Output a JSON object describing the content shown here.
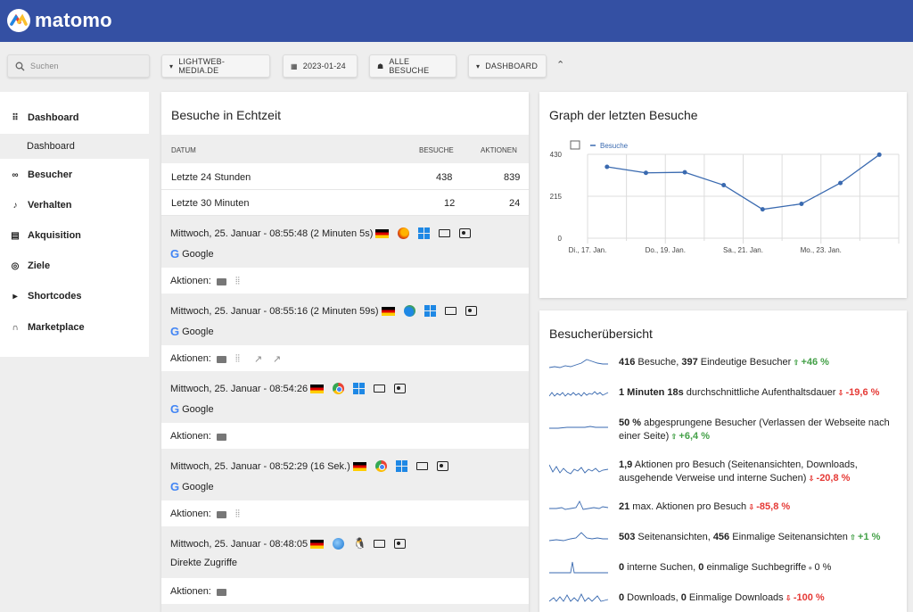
{
  "app": {
    "logo_text": "matomo"
  },
  "toolbar": {
    "search_placeholder": "Suchen",
    "site": "LIGHTWEB-MEDIA.DE",
    "date": "2023-01-24",
    "segment": "ALLE BESUCHE",
    "dashboard": "DASHBOARD"
  },
  "sidebar": {
    "items": [
      {
        "label": "Dashboard",
        "icon": "grid-icon"
      },
      {
        "label": "Besucher",
        "icon": "binoculars-icon"
      },
      {
        "label": "Verhalten",
        "icon": "bell-icon"
      },
      {
        "label": "Akquisition",
        "icon": "calendar-icon"
      },
      {
        "label": "Ziele",
        "icon": "target-icon"
      },
      {
        "label": "Shortcodes",
        "icon": "caret-icon"
      },
      {
        "label": "Marketplace",
        "icon": "headphones-icon"
      }
    ],
    "sub_active": "Dashboard"
  },
  "realtime": {
    "title": "Besuche in Echtzeit",
    "headers": {
      "date": "DATUM",
      "visits": "BESUCHE",
      "actions": "AKTIONEN"
    },
    "rows": [
      {
        "label": "Letzte 24 Stunden",
        "visits": "438",
        "actions": "839"
      },
      {
        "label": "Letzte 30 Minuten",
        "visits": "12",
        "actions": "24"
      }
    ],
    "visits": [
      {
        "time": "Mittwoch, 25. Januar - 08:55:48 (2 Minuten 5s)",
        "referrer": "Google",
        "actions_label": "Aktionen:"
      },
      {
        "time": "Mittwoch, 25. Januar - 08:55:16 (2 Minuten 59s)",
        "referrer": "Google",
        "actions_label": "Aktionen:"
      },
      {
        "time": "Mittwoch, 25. Januar - 08:54:26",
        "referrer": "Google",
        "actions_label": "Aktionen:"
      },
      {
        "time": "Mittwoch, 25. Januar - 08:52:29 (16 Sek.)",
        "referrer": "Google",
        "actions_label": "Aktionen:"
      },
      {
        "time": "Mittwoch, 25. Januar - 08:48:05",
        "referrer": "Direkte Zugriffe",
        "actions_label": "Aktionen:"
      }
    ]
  },
  "graph": {
    "title": "Graph der letzten Besuche",
    "chart_data": {
      "type": "line",
      "x": [
        "Di., 17. Jan.",
        "Mi., 18. Jan.",
        "Do., 19. Jan.",
        "Fr., 20. Jan.",
        "Sa., 21. Jan.",
        "So., 22. Jan.",
        "Mo., 23. Jan.",
        "Di., 24. Jan."
      ],
      "x_tick_labels": [
        "Di., 17. Jan.",
        "Do., 19. Jan.",
        "Sa., 21. Jan.",
        "Mo., 23. Jan."
      ],
      "series": [
        {
          "name": "Besuche",
          "values": [
            366,
            335,
            338,
            272,
            148,
            176,
            283,
            428
          ],
          "color": "#3a6ab0"
        }
      ],
      "y_ticks": [
        "0",
        "215",
        "430"
      ],
      "ylim": [
        0,
        430
      ],
      "grid": true,
      "legend": "top-left"
    }
  },
  "overview": {
    "title": "Besucherübersicht",
    "rows": [
      {
        "bold1": "416",
        "t1": " Besuche, ",
        "bold2": "397",
        "t2": " Eindeutige Besucher",
        "trend": "+46 %",
        "dir": "up"
      },
      {
        "bold1": "1 Minuten 18s",
        "t1": " durchschnittliche Aufenthaltsdauer",
        "bold2": "",
        "t2": "",
        "trend": "-19,6 %",
        "dir": "down"
      },
      {
        "bold1": "50 %",
        "t1": " abgesprungene Besucher (Verlassen der Webseite nach einer Seite)",
        "bold2": "",
        "t2": "",
        "trend": "+6,4 %",
        "dir": "up"
      },
      {
        "bold1": "1,9",
        "t1": " Aktionen pro Besuch (Seitenansichten, Downloads, ausgehende Verweise und interne Suchen)",
        "bold2": "",
        "t2": "",
        "trend": "-20,8 %",
        "dir": "down"
      },
      {
        "bold1": "21",
        "t1": " max. Aktionen pro Besuch",
        "bold2": "",
        "t2": "",
        "trend": "-85,8 %",
        "dir": "down"
      },
      {
        "bold1": "503",
        "t1": " Seitenansichten, ",
        "bold2": "456",
        "t2": " Einmalige Seitenansichten",
        "trend": "+1 %",
        "dir": "up"
      },
      {
        "bold1": "0",
        "t1": " interne Suchen, ",
        "bold2": "0",
        "t2": " einmalige Suchbegriffe",
        "trend": "0 %",
        "dir": "neutral"
      },
      {
        "bold1": "0",
        "t1": " Downloads, ",
        "bold2": "0",
        "t2": " Einmalige Downloads",
        "trend": "-100 %",
        "dir": "down"
      }
    ]
  },
  "colors": {
    "topbar": "#3450a3",
    "accent": "#3a6ab0",
    "up": "#43a047",
    "down": "#e53935"
  }
}
